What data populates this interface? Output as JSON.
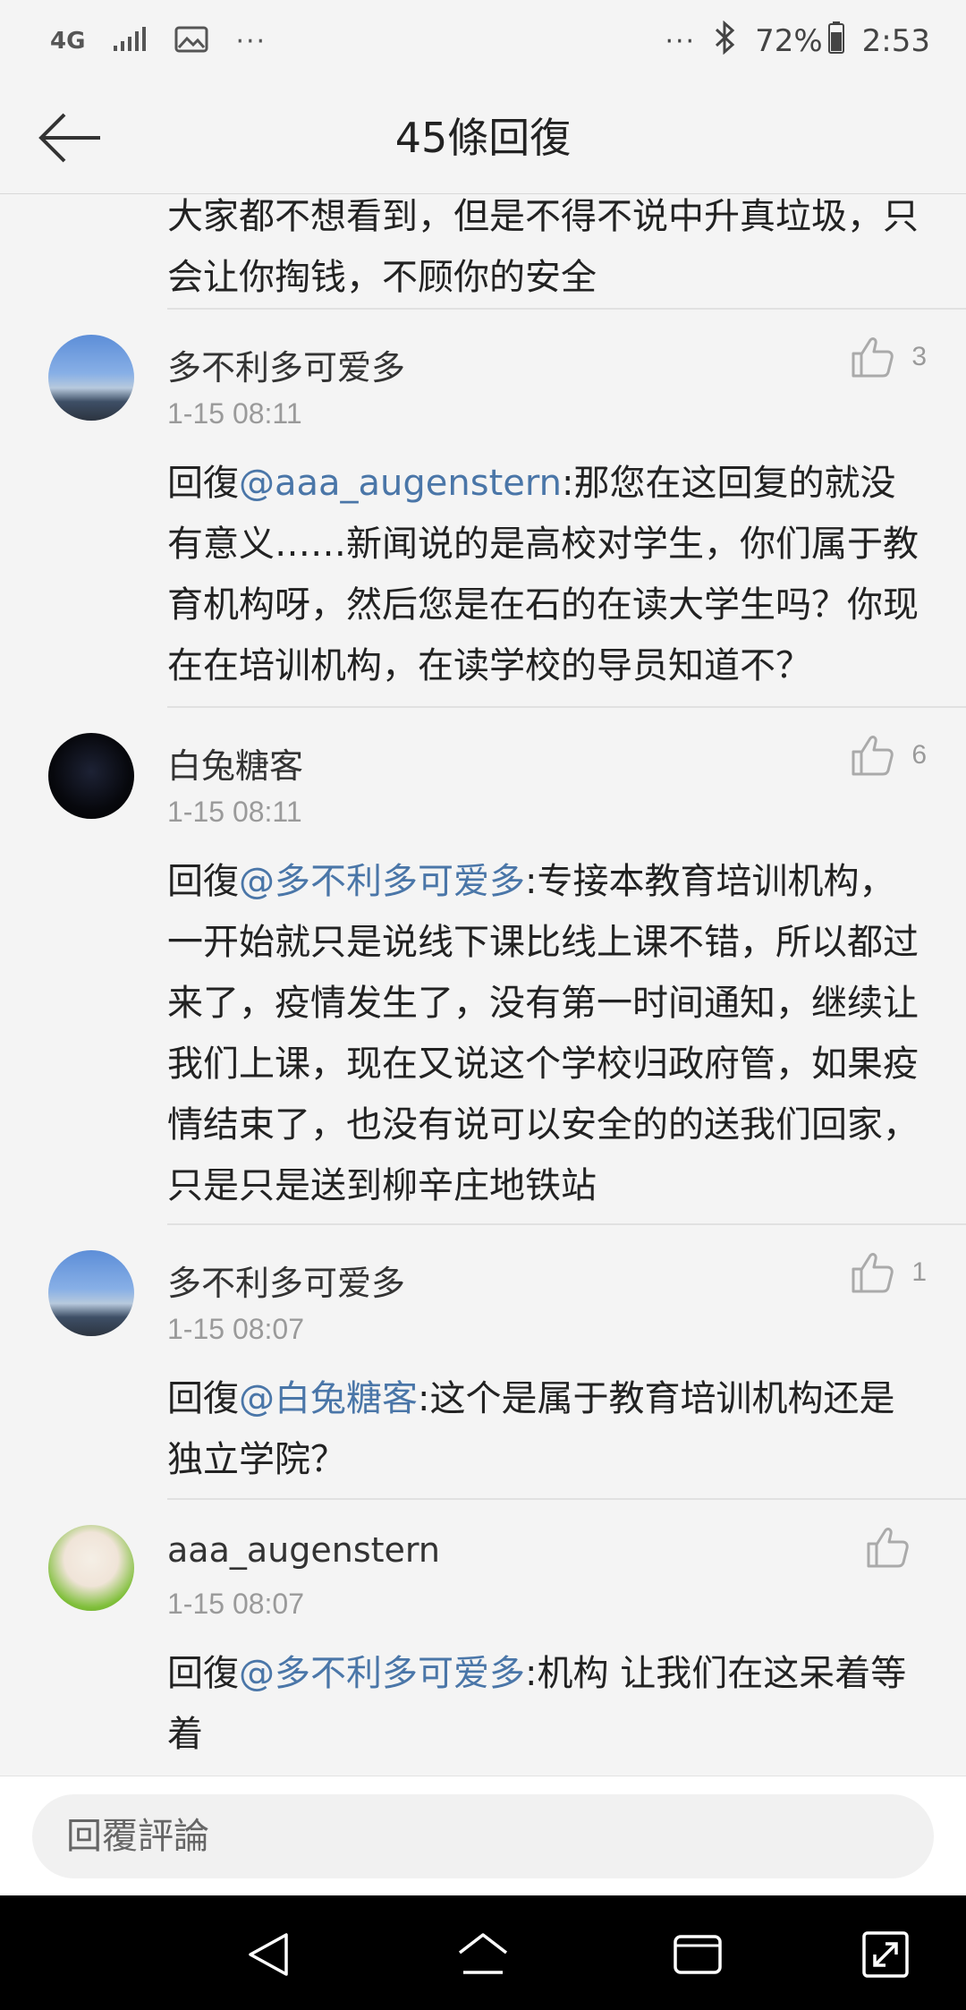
{
  "status_bar": {
    "network": "4G",
    "dots_left": "···",
    "dots_right": "···",
    "battery": "72%",
    "time": "2:53"
  },
  "header": {
    "title": "45條回復"
  },
  "continuation": {
    "text": "大家都不想看到，但是不得不说中升真垃圾，只会让你掏钱，不顾你的安全"
  },
  "comments": [
    {
      "author": "多不利多可爱多",
      "time": "1-15 08:11",
      "likes": "3",
      "reply_prefix": "回復",
      "mention": "@aaa_augenstern",
      "text": ":那您在这回复的就没有意义……新闻说的是高校对学生，你们属于教育机构呀，然后您是在石的在读大学生吗？你现在在培训机构，在读学校的导员知道不？"
    },
    {
      "author": "白兔糖客",
      "time": "1-15 08:11",
      "likes": "6",
      "reply_prefix": "回復",
      "mention": "@多不利多可爱多",
      "text": ":专接本教育培训机构，一开始就只是说线下课比线上课不错，所以都过来了，疫情发生了，没有第一时间通知，继续让我们上课，现在又说这个学校归政府管，如果疫情结束了，也没有说可以安全的的送我们回家，只是只是送到柳辛庄地铁站"
    },
    {
      "author": "多不利多可爱多",
      "time": "1-15 08:07",
      "likes": "1",
      "reply_prefix": "回復",
      "mention": "@白兔糖客",
      "text": ":这个是属于教育培训机构还是独立学院？"
    },
    {
      "author": "aaa_augenstern",
      "time": "1-15 08:07",
      "likes": "",
      "reply_prefix": "回復",
      "mention": "@多不利多可爱多",
      "text": ":机构 让我们在这呆着等着"
    }
  ],
  "reply_bar": {
    "placeholder": "回覆評論"
  },
  "colors": {
    "background": "#f4f4f4",
    "mention": "#4a76a8",
    "secondary_text": "#9a9a9a",
    "divider": "#e1e1e1"
  }
}
